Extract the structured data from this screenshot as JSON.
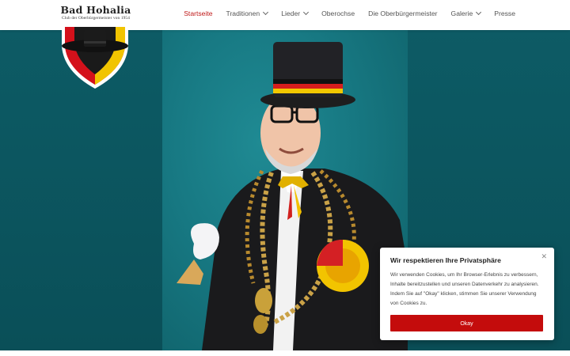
{
  "brand": {
    "name": "Bad Hohalia",
    "subtitle": "Club der Oberbürgermeister von 1954"
  },
  "nav": {
    "items": [
      {
        "label": "Startseite",
        "active": true,
        "dropdown": false
      },
      {
        "label": "Traditionen",
        "active": false,
        "dropdown": true
      },
      {
        "label": "Lieder",
        "active": false,
        "dropdown": true
      },
      {
        "label": "Oberochse",
        "active": false,
        "dropdown": false
      },
      {
        "label": "Die Oberbürgermeister",
        "active": false,
        "dropdown": false
      },
      {
        "label": "Galerie",
        "active": false,
        "dropdown": true
      },
      {
        "label": "Presse",
        "active": false,
        "dropdown": false
      }
    ]
  },
  "cookie": {
    "title": "Wir respektieren Ihre Privatsphäre",
    "text": "Wir verwenden Cookies, um Ihr Browser-Erlebnis zu verbessern, Inhalte bereitzustellen und unseren Datenverkehr zu analysieren. Indem Sie auf \"Okay\" klicken, stimmen Sie unserer Verwendung von Cookies zu.",
    "button_label": "Okay",
    "close_icon": "close-icon"
  },
  "colors": {
    "accent": "#c01a1a",
    "button": "#c40c0c",
    "hero_background": "#0c5a63"
  }
}
